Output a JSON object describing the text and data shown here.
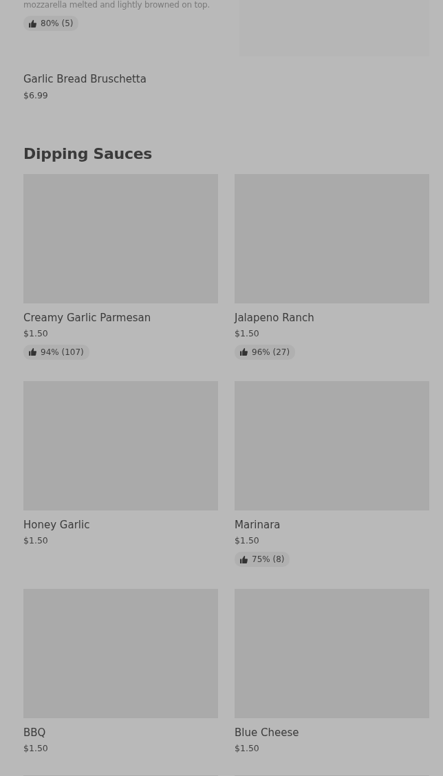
{
  "featured_item": {
    "description": "mozzarella melted and lightly browned on top.",
    "rating": "80% (5)"
  },
  "menu_items": [
    {
      "name": "Garlic Bread Bruschetta",
      "price": "$6.99"
    }
  ],
  "section": {
    "title": "Dipping Sauces",
    "items": [
      {
        "kind": "item",
        "name": "Creamy Garlic Parmesan",
        "price": "$1.50",
        "rating": "94% (107)"
      },
      {
        "kind": "item",
        "name": "Jalapeno Ranch",
        "price": "$1.50",
        "rating": "96% (27)"
      },
      {
        "kind": "item",
        "name": "Honey Garlic",
        "price": "$1.50"
      },
      {
        "kind": "item",
        "name": "Marinara",
        "price": "$1.50",
        "rating": "75% (8)"
      },
      {
        "kind": "item",
        "name": "BBQ",
        "price": "$1.50"
      },
      {
        "kind": "item",
        "name": "Blue Cheese",
        "price": "$1.50"
      },
      {
        "kind": "picture"
      },
      {
        "kind": "picture"
      }
    ]
  }
}
